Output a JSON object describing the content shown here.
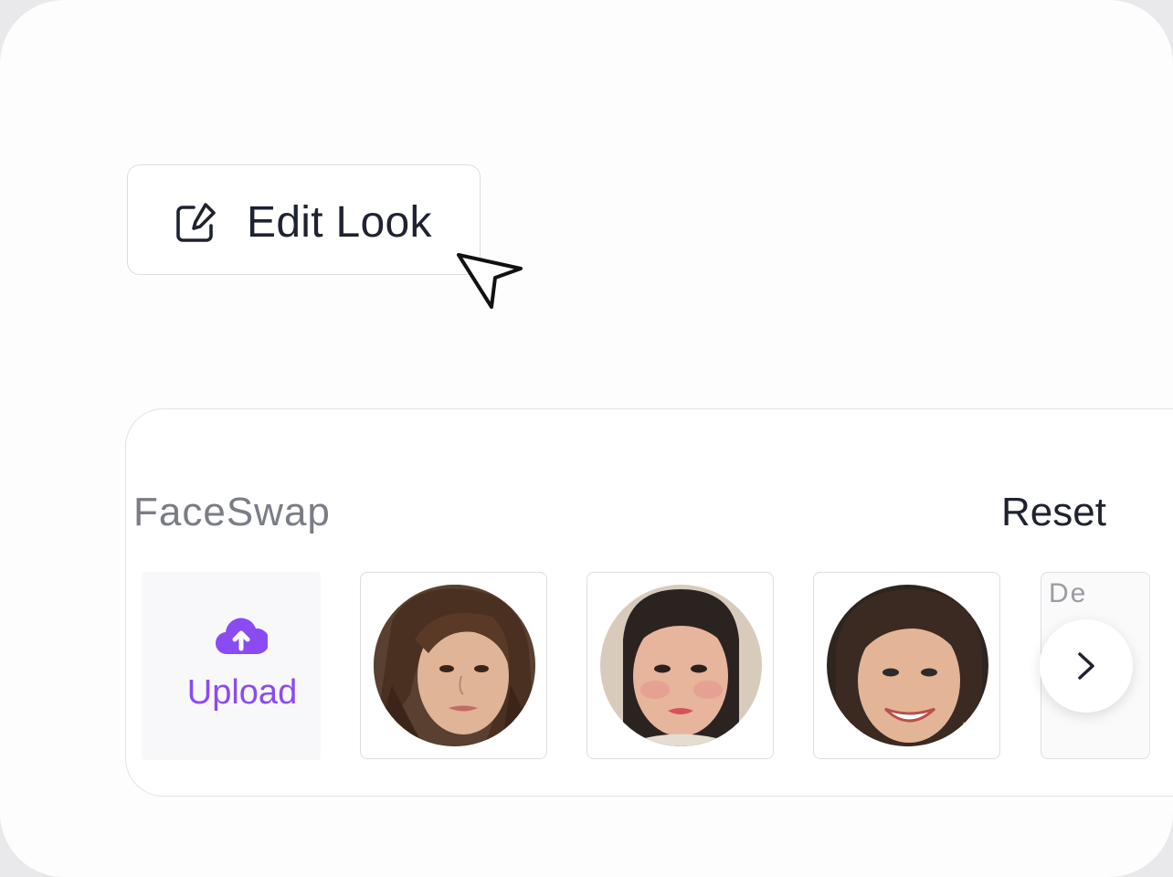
{
  "edit_look": {
    "label": "Edit Look",
    "icon": "edit-square-icon"
  },
  "cursor": {
    "icon": "pointer-arrow-icon"
  },
  "faceswap_panel": {
    "title": "FaceSwap",
    "reset_label": "Reset",
    "upload": {
      "label": "Upload",
      "icon": "cloud-upload-icon",
      "color": "#8a4bf2"
    },
    "faces": [
      {
        "name": "face-option-1",
        "description_hidden": true
      },
      {
        "name": "face-option-2",
        "description_hidden": true
      },
      {
        "name": "face-option-3",
        "description_hidden": true
      }
    ],
    "partial_card_label": "De",
    "next_icon": "chevron-right-icon"
  },
  "colors": {
    "accent": "#8a4bf2",
    "text_dark": "#1f2230",
    "text_muted": "#7a7c86",
    "border": "#dcdde3"
  }
}
